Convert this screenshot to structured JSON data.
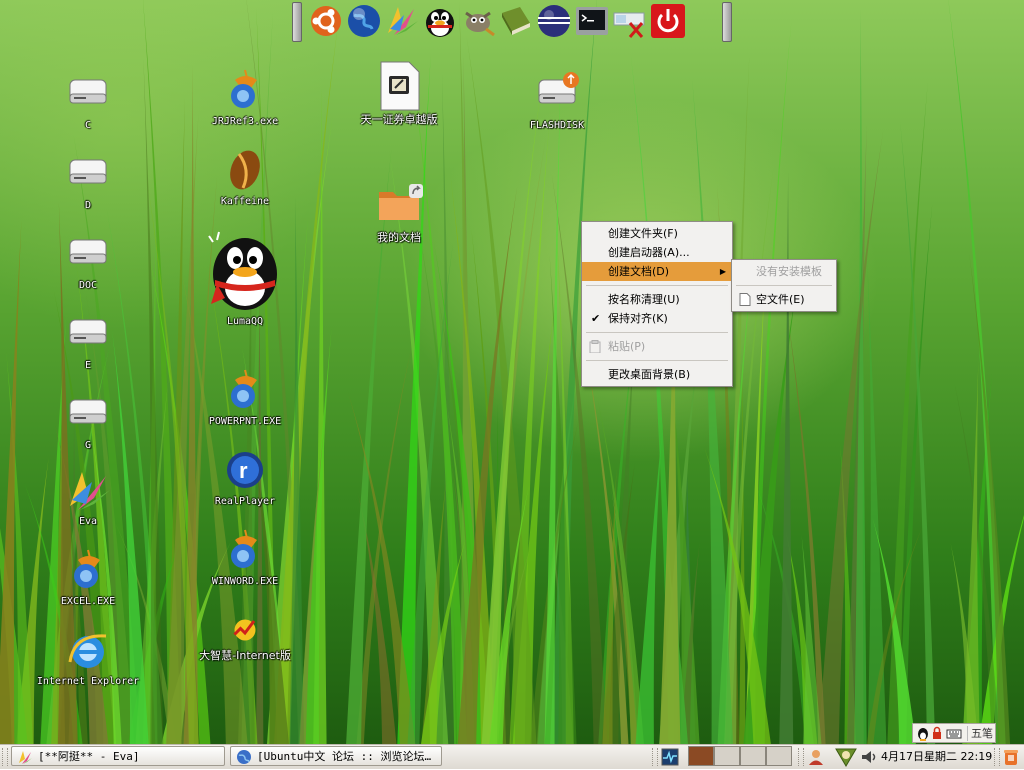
{
  "launcher": {
    "icons": [
      "ubuntu-icon",
      "globe-icon",
      "eva-icon",
      "qq-penguin-icon",
      "gimp-icon",
      "book-icon",
      "eclipse-icon",
      "terminal-icon",
      "disconnect-icon",
      "power-icon"
    ]
  },
  "desktop_icons": {
    "c": "C",
    "d": "D",
    "doc": "DOC",
    "e": "E",
    "g": "G",
    "eva": "Eva",
    "excel": "EXCEL.EXE",
    "ie": "Internet Explorer",
    "jrj": "JRJRef3.exe",
    "kaffeine": "Kaffeine",
    "lumaqq": "LumaQQ",
    "powerpnt": "POWERPNT.EXE",
    "realplayer": "RealPlayer",
    "winword": "WINWORD.EXE",
    "dazhihui": "大智慧-Internet版",
    "tianyi": "天一证券卓越版",
    "mydocs": "我的文档",
    "flashdisk": "FLASHDISK"
  },
  "context_menu": {
    "create_folder": "创建文件夹(F)",
    "create_launcher": "创建启动器(A)...",
    "create_document": "创建文档(D)",
    "sort_by_name": "按名称清理(U)",
    "keep_aligned": "保持对齐(K)",
    "keep_aligned_checked": true,
    "check_mark": "✔",
    "paste": "粘贴(P)",
    "change_background": "更改桌面背景(B)"
  },
  "submenu": {
    "no_templates": "没有安装模板",
    "empty_file": "空文件(E)"
  },
  "taskbar": {
    "task1": "[**阿挺** - Eva]",
    "task2": "[Ubuntu中文 论坛 :: 浏览论坛…",
    "clock": "4月17日星期二  22:19"
  },
  "ime": {
    "mode": "五笔"
  },
  "colors": {
    "menu_highlight": "#e59c3b",
    "menu_bg": "#f2f1ef",
    "grass_dark": "#1e5c10",
    "grass_light": "#8ec95a"
  }
}
